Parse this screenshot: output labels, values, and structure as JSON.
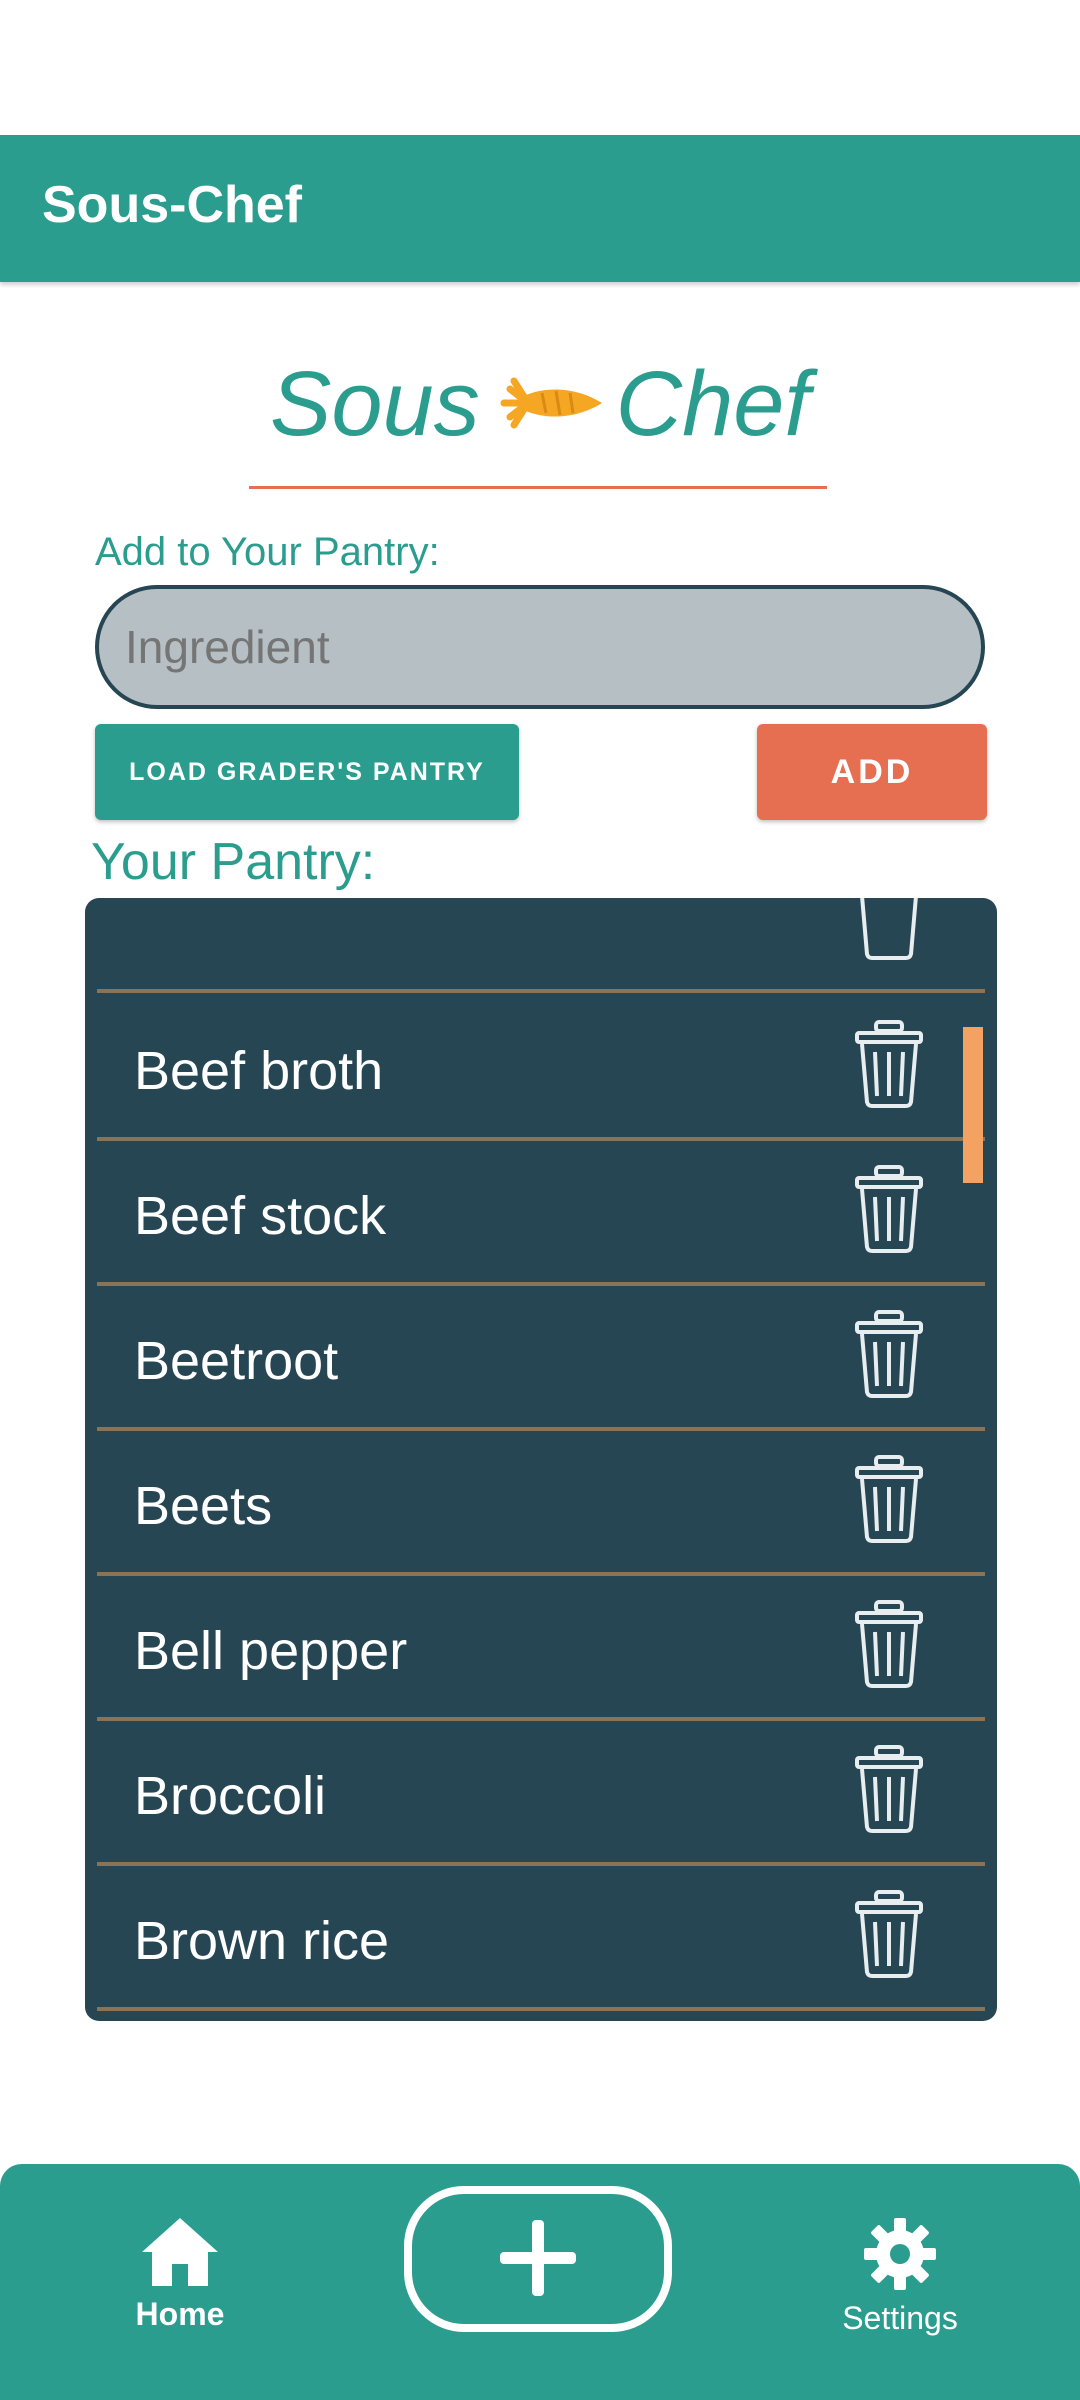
{
  "app_bar": {
    "title": "Sous-Chef"
  },
  "logo": {
    "left_word": "Sous",
    "right_word": "Chef",
    "icon": "carrot-icon"
  },
  "add_form": {
    "label": "Add to Your Pantry:",
    "input_placeholder": "Ingredient",
    "input_value": "",
    "load_button_label": "LOAD GRADER'S PANTRY",
    "add_button_label": "ADD"
  },
  "pantry": {
    "heading": "Your Pantry:",
    "items": [
      {
        "label": "Beef broth",
        "icon": "trash-icon"
      },
      {
        "label": "Beef stock",
        "icon": "trash-icon"
      },
      {
        "label": "Beetroot",
        "icon": "trash-icon"
      },
      {
        "label": "Beets",
        "icon": "trash-icon"
      },
      {
        "label": "Bell pepper",
        "icon": "trash-icon"
      },
      {
        "label": "Broccoli",
        "icon": "trash-icon"
      },
      {
        "label": "Brown rice",
        "icon": "trash-icon"
      }
    ]
  },
  "bottom_nav": {
    "home_label": "Home",
    "settings_label": "Settings",
    "add_icon": "plus-icon",
    "home_icon": "home-icon",
    "settings_icon": "gear-icon"
  },
  "colors": {
    "primary": "#2a9d8f",
    "accent": "#e76f51",
    "panel": "#264653",
    "scrollbar": "#f4a261",
    "divider": "#8b7355"
  }
}
